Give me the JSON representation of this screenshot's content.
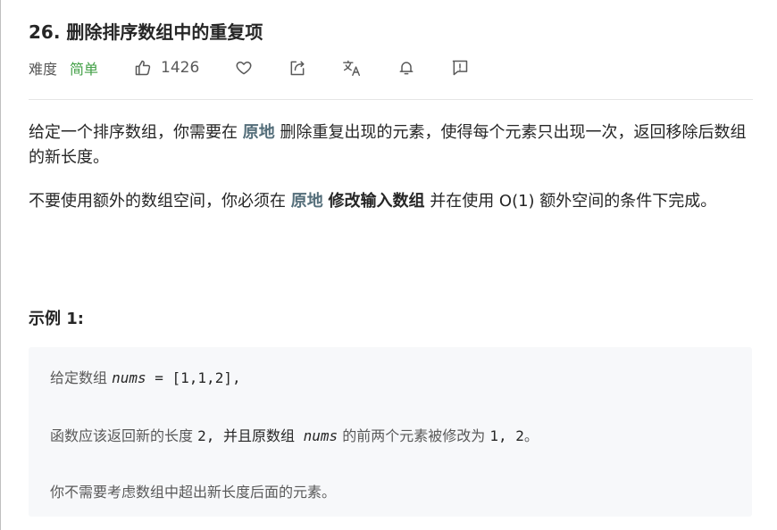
{
  "problem": {
    "title": "26. 删除排序数组中的重复项",
    "difficulty_label": "难度",
    "difficulty_value": "简单",
    "likes": "1426",
    "difficulty_color": "#43a047",
    "highlight_color": "#546e7a"
  },
  "icons": {
    "like": "thumbs-up-icon",
    "favorite": "heart-icon",
    "share": "share-icon",
    "translate": "translate-icon",
    "subscribe": "bell-icon",
    "feedback": "feedback-icon"
  },
  "description": {
    "p1_a": "给定一个排序数组，你需要在 ",
    "p1_hl": "原地",
    "p1_b": " 删除重复出现的元素，使得每个元素只出现一次，返回移除后数组的新长度。",
    "p2_a": "不要使用额外的数组空间，你必须在 ",
    "p2_hl": "原地",
    "p2_space": " ",
    "p2_strong": "修改输入数组",
    "p2_b": " 并在使用 O(1) 额外空间的条件下完成。"
  },
  "example": {
    "title": "示例 1:",
    "line1_a": "给定数组 ",
    "line1_var": "nums",
    "line1_b": " = [1,1,2],",
    "line2_a": "函数应该返回新的长度 ",
    "line2_num": "2",
    "line2_b": ", 并且原数组 ",
    "line2_var": "nums",
    "line2_c": " 的前两个元素被修改为 ",
    "line2_vals": "1, 2",
    "line2_d": "。",
    "line3": "你不需要考虑数组中超出新长度后面的元素。"
  }
}
